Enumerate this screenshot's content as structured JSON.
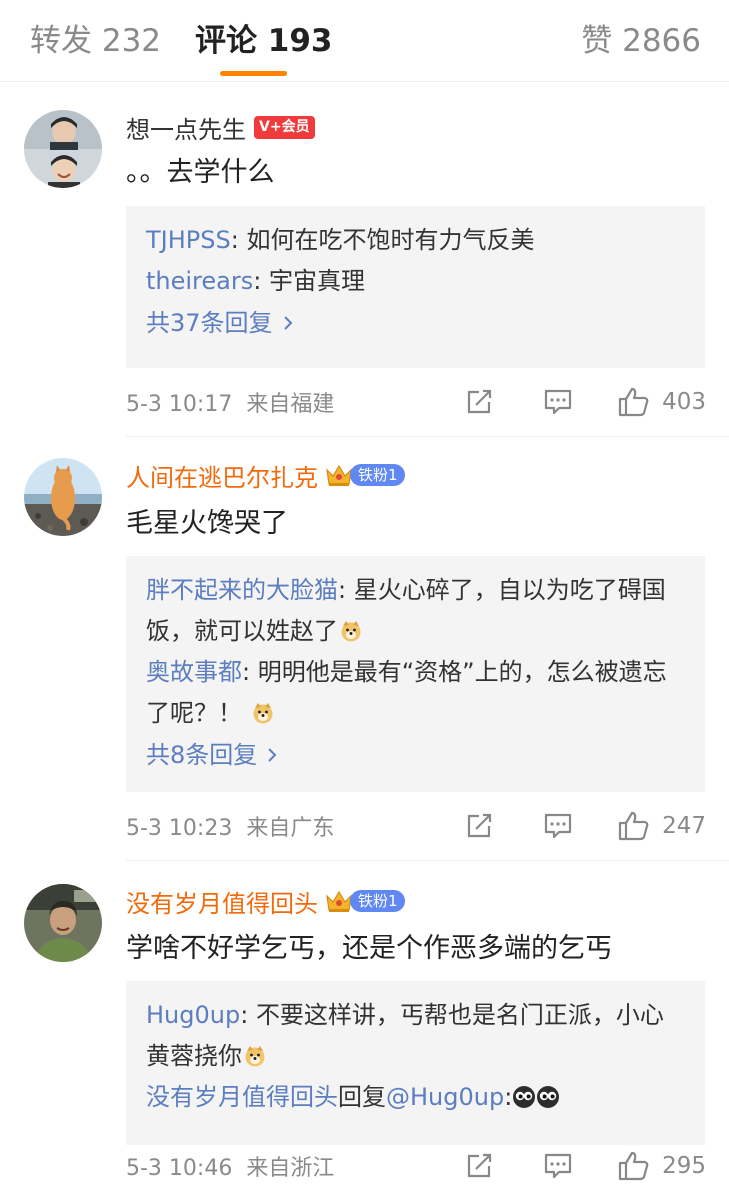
{
  "tabs": {
    "reposts": "转发 232",
    "comments": "评论 193",
    "likes": "赞 2866",
    "active": "comments",
    "accent_color": "#ff8200"
  },
  "colors": {
    "username_vip": "#f36a0c",
    "reply_name": "#5c7ec0",
    "fan_badge": "#5f88f2",
    "vip_badge": "#ef3b3b"
  },
  "comments": [
    {
      "username": "想一点先生",
      "badge": "V+会员",
      "text": "。。去学什么",
      "replies": [
        {
          "name": "TJHPSS",
          "sep": ": ",
          "text": "如何在吃不饱时有力气反美"
        },
        {
          "name": "theirears",
          "sep": ": ",
          "text": "宇宙真理"
        }
      ],
      "more_replies": "共37条回复",
      "time": "5-3 10:17",
      "location": "来自福建",
      "likes": "403"
    },
    {
      "username": "人间在逃巴尔扎克",
      "badge": "铁粉1",
      "text": "毛星火馋哭了",
      "replies": [
        {
          "name": "胖不起来的大脸猫",
          "sep": ": ",
          "text": "星火心碎了，自以为吃了碍国饭，就可以姓赵了",
          "emoji": "doge"
        },
        {
          "name": "奥故事都",
          "sep": ": ",
          "text": "明明他是最有“资格”上的，怎么被遗忘了呢？！",
          "emoji": "doge"
        }
      ],
      "more_replies": "共8条回复",
      "time": "5-3 10:23",
      "location": "来自广东",
      "likes": "247"
    },
    {
      "username": "没有岁月值得回头",
      "badge": "铁粉1",
      "text": "学啥不好学乞丐，还是个作恶多端的乞丐",
      "replies": [
        {
          "name": "Hug0up",
          "sep": ": ",
          "text": "不要这样讲，丐帮也是名门正派，小心黄蓉挠你",
          "emoji": "doge"
        },
        {
          "name": "没有岁月值得回头",
          "mid": "回复",
          "at": "@Hug0up",
          "sep": ":",
          "emoji": "eyes"
        }
      ],
      "time": "5-3 10:46",
      "location": "来自浙江",
      "likes": "295"
    }
  ]
}
